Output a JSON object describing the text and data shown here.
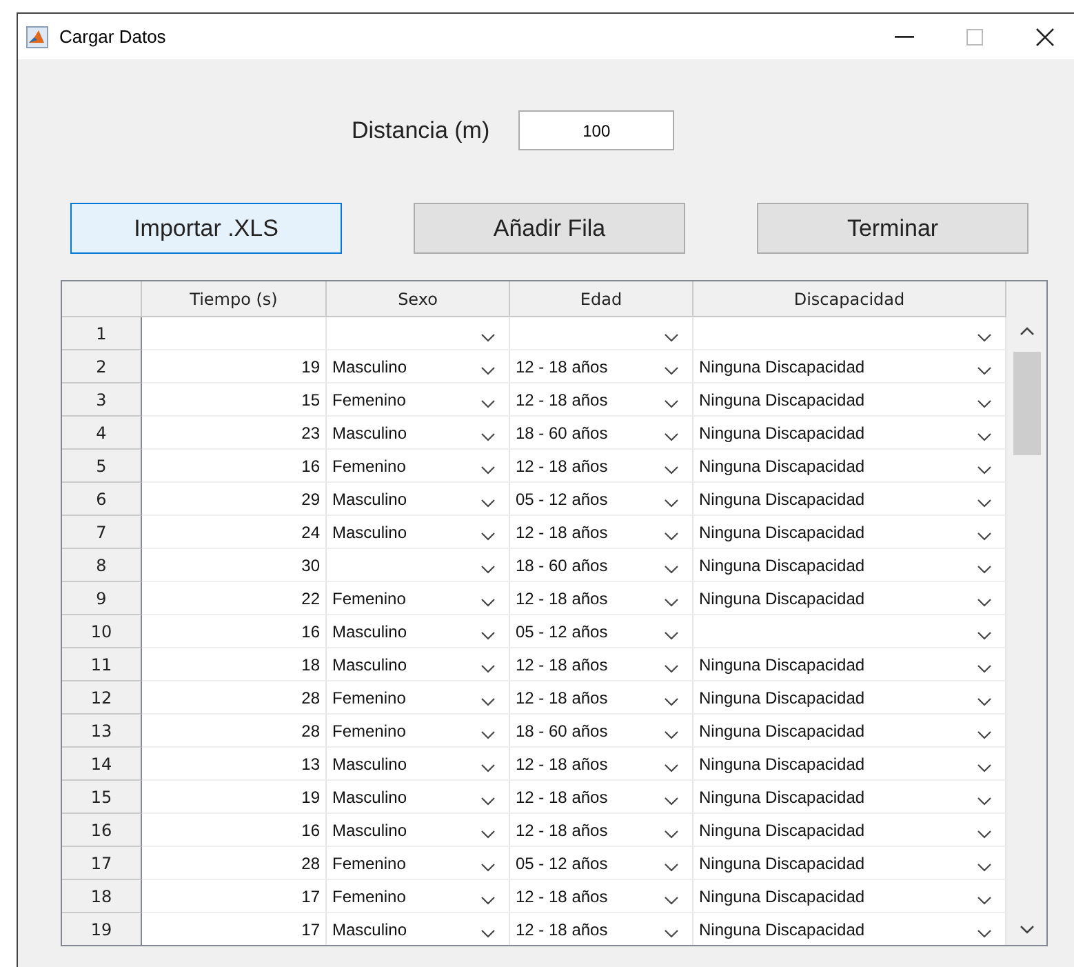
{
  "window": {
    "title": "Cargar Datos"
  },
  "distance": {
    "label": "Distancia (m)",
    "value": "100"
  },
  "buttons": [
    {
      "label": "Importar .XLS",
      "focused": true
    },
    {
      "label": "Añadir Fila",
      "focused": false
    },
    {
      "label": "Terminar",
      "focused": false
    }
  ],
  "table": {
    "columns": [
      "Tiempo (s)",
      "Sexo",
      "Edad",
      "Discapacidad"
    ],
    "rows": [
      {
        "row": "1"
      },
      {
        "row": "2",
        "tiempo": "19",
        "sexo": "Masculino",
        "edad": "12 - 18 años",
        "discapacidad": "Ninguna Discapacidad"
      },
      {
        "row": "3",
        "tiempo": "15",
        "sexo": "Femenino",
        "edad": "12 - 18 años",
        "discapacidad": "Ninguna Discapacidad"
      },
      {
        "row": "4",
        "tiempo": "23",
        "sexo": "Masculino",
        "edad": "18 - 60 años",
        "discapacidad": "Ninguna Discapacidad"
      },
      {
        "row": "5",
        "tiempo": "16",
        "sexo": "Femenino",
        "edad": "12 - 18 años",
        "discapacidad": "Ninguna Discapacidad"
      },
      {
        "row": "6",
        "tiempo": "29",
        "sexo": "Masculino",
        "edad": "05 - 12 años",
        "discapacidad": "Ninguna Discapacidad"
      },
      {
        "row": "7",
        "tiempo": "24",
        "sexo": "Masculino",
        "edad": "12 - 18 años",
        "discapacidad": "Ninguna Discapacidad"
      },
      {
        "row": "8",
        "tiempo": "30",
        "edad": "18 - 60 años",
        "discapacidad": "Ninguna Discapacidad"
      },
      {
        "row": "9",
        "tiempo": "22",
        "sexo": "Femenino",
        "edad": "12 - 18 años",
        "discapacidad": "Ninguna Discapacidad"
      },
      {
        "row": "10",
        "tiempo": "16",
        "sexo": "Masculino",
        "edad": "05 - 12 años"
      },
      {
        "row": "11",
        "tiempo": "18",
        "sexo": "Masculino",
        "edad": "12 - 18 años",
        "discapacidad": "Ninguna Discapacidad"
      },
      {
        "row": "12",
        "tiempo": "28",
        "sexo": "Femenino",
        "edad": "12 - 18 años",
        "discapacidad": "Ninguna Discapacidad"
      },
      {
        "row": "13",
        "tiempo": "28",
        "sexo": "Femenino",
        "edad": "18 - 60 años",
        "discapacidad": "Ninguna Discapacidad"
      },
      {
        "row": "14",
        "tiempo": "13",
        "sexo": "Masculino",
        "edad": "12 - 18 años",
        "discapacidad": "Ninguna Discapacidad"
      },
      {
        "row": "15",
        "tiempo": "19",
        "sexo": "Masculino",
        "edad": "12 - 18 años",
        "discapacidad": "Ninguna Discapacidad"
      },
      {
        "row": "16",
        "tiempo": "16",
        "sexo": "Masculino",
        "edad": "12 - 18 años",
        "discapacidad": "Ninguna Discapacidad"
      },
      {
        "row": "17",
        "tiempo": "28",
        "sexo": "Femenino",
        "edad": "05 - 12 años",
        "discapacidad": "Ninguna Discapacidad"
      },
      {
        "row": "18",
        "tiempo": "17",
        "sexo": "Femenino",
        "edad": "12 - 18 años",
        "discapacidad": "Ninguna Discapacidad"
      },
      {
        "row": "19",
        "tiempo": "17",
        "sexo": "Masculino",
        "edad": "12 - 18 años",
        "discapacidad": "Ninguna Discapacidad"
      }
    ]
  }
}
